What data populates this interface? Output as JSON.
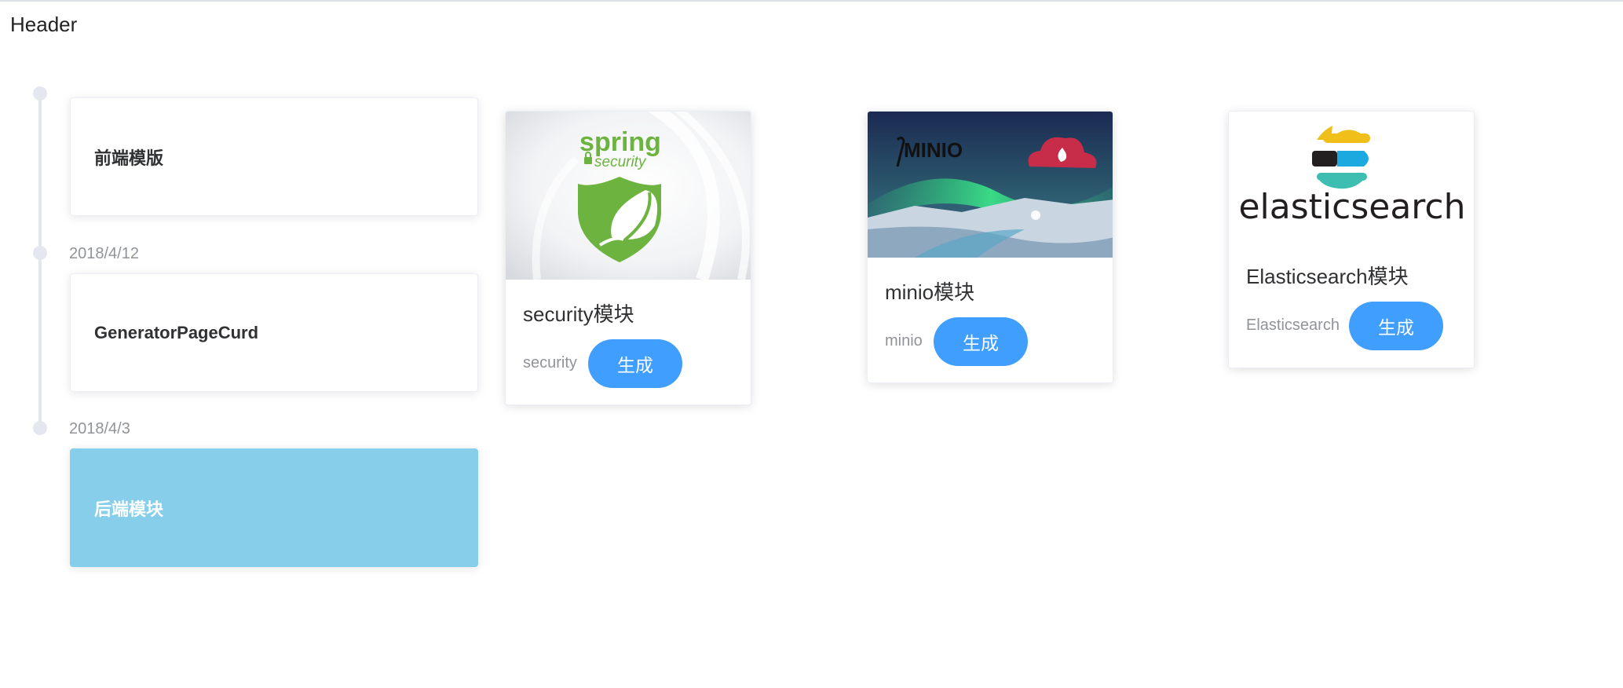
{
  "header": {
    "title": "Header"
  },
  "timeline": [
    {
      "time": "",
      "title": "前端模版",
      "active": false
    },
    {
      "time": "2018/4/12",
      "title": "GeneratorPageCurd",
      "active": false
    },
    {
      "time": "2018/4/3",
      "title": "后端模块",
      "active": true
    }
  ],
  "modules": [
    {
      "title": "security模块",
      "tag": "security",
      "button": "生成",
      "logo": {
        "word1": "spring",
        "word2": "security",
        "icon": "shield-leaf-icon"
      }
    },
    {
      "title": "minio模块",
      "tag": "minio",
      "button": "生成",
      "logo": {
        "word1": "MINIO",
        "icon": "aurora-landscape"
      }
    },
    {
      "title": "Elasticsearch模块",
      "tag": "Elasticsearch",
      "button": "生成",
      "logo": {
        "word1": "elasticsearch",
        "icon": "elastic-logo-icon"
      }
    }
  ],
  "colors": {
    "primary": "#409eff",
    "active_card": "#87ceeb",
    "spring_green": "#6db33f",
    "minio_red": "#c72c48"
  }
}
